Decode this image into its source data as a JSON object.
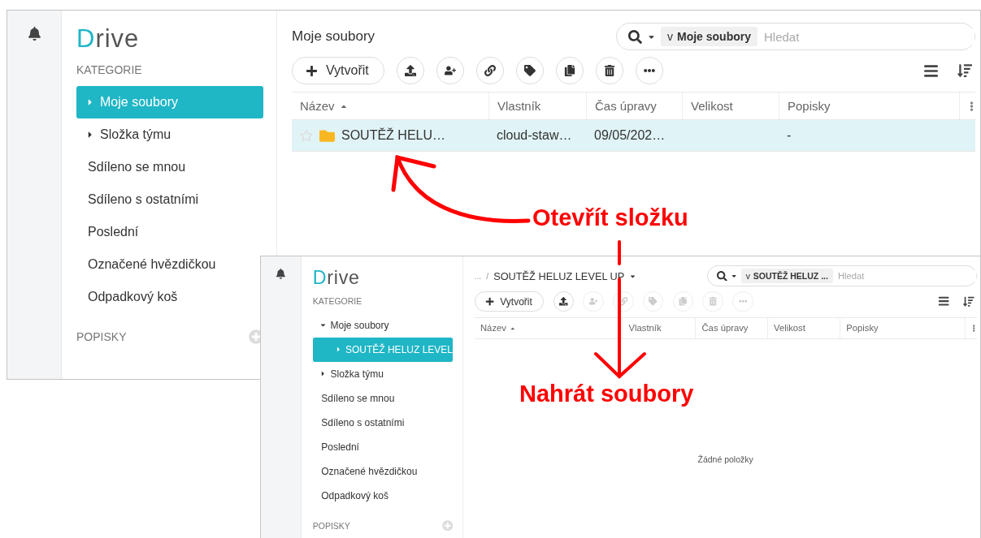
{
  "screenshots": [
    {
      "sidebar": {
        "logo": "Drive",
        "section_title": "KATEGORIE",
        "items": [
          {
            "label": "Moje soubory",
            "kind": "folder",
            "expanded": false,
            "selected": true
          },
          {
            "label": "Složka týmu",
            "kind": "folder",
            "expanded": false,
            "selected": false
          },
          {
            "label": "Sdíleno se mnou",
            "kind": "link",
            "selected": false
          },
          {
            "label": "Sdíleno s ostatními",
            "kind": "link",
            "selected": false
          },
          {
            "label": "Poslední",
            "kind": "link",
            "selected": false
          },
          {
            "label": "Označené hvězdičkou",
            "kind": "link",
            "selected": false
          },
          {
            "label": "Odpadkový koš",
            "kind": "link",
            "selected": false
          }
        ],
        "labels_title": "POPISKY"
      },
      "header": {
        "kind": "title",
        "title": "Moje soubory"
      },
      "search": {
        "scope_prefix": "v",
        "scope": "Moje soubory",
        "placeholder": "Hledat"
      },
      "toolbar": {
        "create_label": "Vytvořit",
        "actions": [
          {
            "kind": "upload",
            "disabled": false
          },
          {
            "kind": "share",
            "disabled": false
          },
          {
            "kind": "link",
            "disabled": false
          },
          {
            "kind": "tag",
            "disabled": false
          },
          {
            "kind": "copy",
            "disabled": false
          },
          {
            "kind": "delete",
            "disabled": false
          },
          {
            "kind": "more",
            "disabled": false
          }
        ]
      },
      "table": {
        "columns": [
          {
            "label": "Název",
            "sorted": true
          },
          {
            "label": "Vlastník",
            "sorted": false
          },
          {
            "label": "Čas úpravy",
            "sorted": false
          },
          {
            "label": "Velikost",
            "sorted": false
          },
          {
            "label": "Popisky",
            "sorted": false
          }
        ],
        "rows": [
          {
            "starred": false,
            "selected": true,
            "name": "SOUTĚŽ HELU…",
            "owner": "cloud-staw…",
            "modified": "09/05/202…",
            "labels": "-"
          }
        ]
      }
    },
    {
      "sidebar": {
        "logo": "Drive",
        "section_title": "KATEGORIE",
        "items": [
          {
            "label": "Moje soubory",
            "kind": "folder",
            "expanded": true,
            "selected": false,
            "children": [
              {
                "label": "SOUTĚŽ HELUZ LEVEL",
                "kind": "folder",
                "expanded": false,
                "selected": true
              }
            ]
          },
          {
            "label": "Složka týmu",
            "kind": "folder",
            "expanded": false,
            "selected": false
          },
          {
            "label": "Sdíleno se mnou",
            "kind": "link",
            "selected": false
          },
          {
            "label": "Sdíleno s ostatními",
            "kind": "link",
            "selected": false
          },
          {
            "label": "Poslední",
            "kind": "link",
            "selected": false
          },
          {
            "label": "Označené hvězdičkou",
            "kind": "link",
            "selected": false
          },
          {
            "label": "Odpadkový koš",
            "kind": "link",
            "selected": false
          }
        ],
        "labels_title": "POPISKY"
      },
      "header": {
        "kind": "breadcrumb",
        "ellipsis": "...",
        "separator": "/",
        "title": "SOUTĚŽ HELUZ LEVEL UP"
      },
      "search": {
        "scope_prefix": "v",
        "scope": "SOUTĚŽ HELUZ ...",
        "placeholder": "Hledat"
      },
      "toolbar": {
        "create_label": "Vytvořit",
        "actions": [
          {
            "kind": "upload",
            "disabled": false
          },
          {
            "kind": "share",
            "disabled": true
          },
          {
            "kind": "link",
            "disabled": true
          },
          {
            "kind": "tag",
            "disabled": true
          },
          {
            "kind": "copy",
            "disabled": true
          },
          {
            "kind": "delete",
            "disabled": true
          },
          {
            "kind": "more",
            "disabled": true
          }
        ]
      },
      "table": {
        "columns": [
          {
            "label": "Název",
            "sorted": true
          },
          {
            "label": "Vlastník",
            "sorted": false
          },
          {
            "label": "Čas úpravy",
            "sorted": false
          },
          {
            "label": "Velikost",
            "sorted": false
          },
          {
            "label": "Popisky",
            "sorted": false
          }
        ],
        "empty_message": "Žádné položky"
      }
    }
  ],
  "annotations": [
    {
      "kind": "curved",
      "text": "Otevřít složku"
    },
    {
      "kind": "down",
      "text": "Nahrát soubory"
    }
  ]
}
